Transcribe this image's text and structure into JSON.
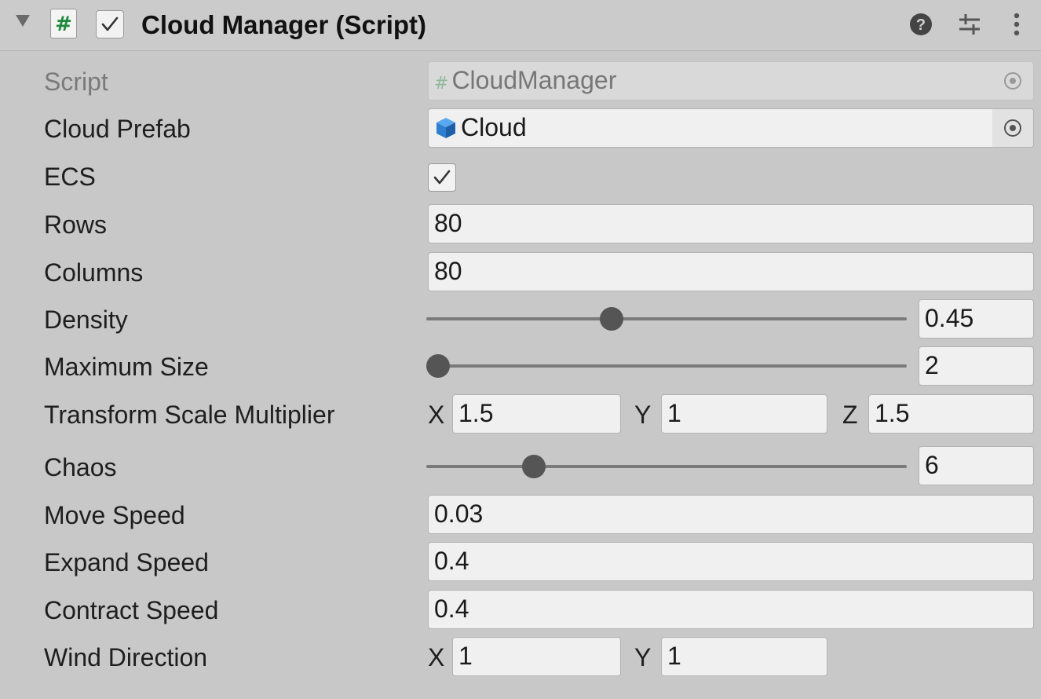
{
  "component": {
    "title": "Cloud Manager (Script)",
    "script_icon_glyph": "#",
    "enabled": true,
    "icons": [
      "foldout-arrow-icon",
      "script-hash-icon",
      "help-icon",
      "presets-icon",
      "more-options-icon"
    ]
  },
  "fields": {
    "script": {
      "label": "Script",
      "value": "CloudManager"
    },
    "cloud_prefab": {
      "label": "Cloud Prefab",
      "value": "Cloud"
    },
    "ecs": {
      "label": "ECS",
      "checked": true
    },
    "rows": {
      "label": "Rows",
      "value": "80"
    },
    "columns": {
      "label": "Columns",
      "value": "80"
    },
    "density": {
      "label": "Density",
      "value": "0.45",
      "slider_fraction": 0.38
    },
    "maximum_size": {
      "label": "Maximum Size",
      "value": "2",
      "slider_fraction": 0.0
    },
    "transform_scale_multiplier": {
      "label": "Transform Scale Multiplier",
      "x_label": "X",
      "x": "1.5",
      "y_label": "Y",
      "y": "1",
      "z_label": "Z",
      "z": "1.5"
    },
    "chaos": {
      "label": "Chaos",
      "value": "6",
      "slider_fraction": 0.21
    },
    "move_speed": {
      "label": "Move Speed",
      "value": "0.03"
    },
    "expand_speed": {
      "label": "Expand Speed",
      "value": "0.4"
    },
    "contract_speed": {
      "label": "Contract Speed",
      "value": "0.4"
    },
    "wind_direction": {
      "label": "Wind Direction",
      "x_label": "X",
      "x": "1",
      "y_label": "Y",
      "y": "1"
    }
  },
  "colors": {
    "background": "#c8c8c8",
    "field_bg": "#f0f0f0",
    "script_icon_green": "#1e8a3c",
    "prefab_icon_blue": "#2f7fd0",
    "slider_thumb": "#555555"
  }
}
